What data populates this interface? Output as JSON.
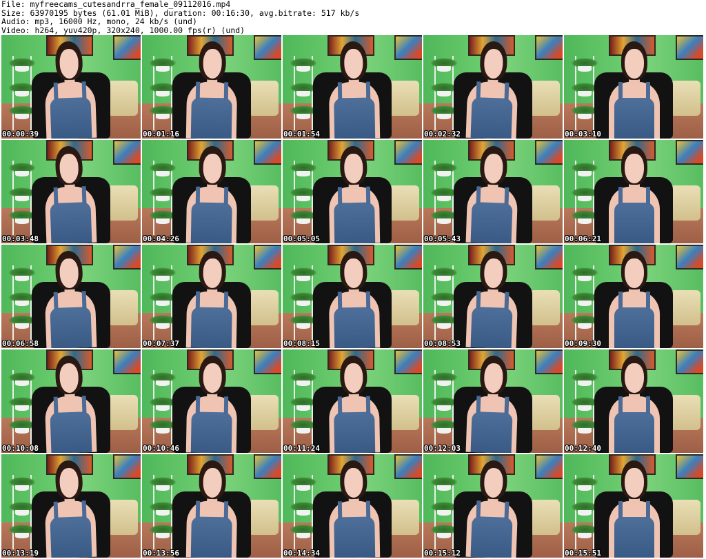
{
  "header": {
    "file": "File: myfreecams_cutesandrra_female_09112016.mp4",
    "size": "Size: 63970195 bytes (61.01 MiB), duration: 00:16:30, avg.bitrate: 517 kb/s",
    "audio": "Audio: mp3, 16000 Hz, mono, 24 kb/s (und)",
    "video": "Video: h264, yuv420p, 320x240, 1000.00 fps(r) (und)"
  },
  "thumbnails": [
    {
      "time": "00:00:39"
    },
    {
      "time": "00:01:16"
    },
    {
      "time": "00:01:54"
    },
    {
      "time": "00:02:32"
    },
    {
      "time": "00:03:10"
    },
    {
      "time": "00:03:48"
    },
    {
      "time": "00:04:26"
    },
    {
      "time": "00:05:05"
    },
    {
      "time": "00:05:43"
    },
    {
      "time": "00:06:21"
    },
    {
      "time": "00:06:58"
    },
    {
      "time": "00:07:37"
    },
    {
      "time": "00:08:15"
    },
    {
      "time": "00:08:53"
    },
    {
      "time": "00:09:30"
    },
    {
      "time": "00:10:08"
    },
    {
      "time": "00:10:46"
    },
    {
      "time": "00:11:24"
    },
    {
      "time": "00:12:03"
    },
    {
      "time": "00:12:40"
    },
    {
      "time": "00:13:19"
    },
    {
      "time": "00:13:56"
    },
    {
      "time": "00:14:34"
    },
    {
      "time": "00:15:12"
    },
    {
      "time": "00:15:51"
    }
  ]
}
